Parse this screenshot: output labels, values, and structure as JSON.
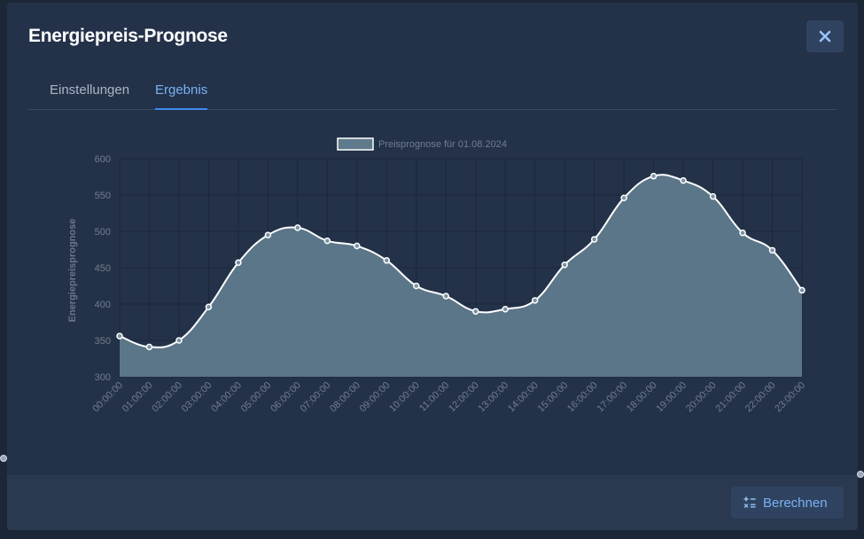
{
  "modal": {
    "title": "Energiepreis-Prognose",
    "close_icon": "close-icon"
  },
  "tabs": [
    {
      "label": "Einstellungen",
      "active": false
    },
    {
      "label": "Ergebnis",
      "active": true
    }
  ],
  "footer": {
    "calculate_label": "Berechnen",
    "calculate_icon": "calculator-icon"
  },
  "colors": {
    "accent": "#7ab1f5",
    "area_fill": "#5f7a8c",
    "line": "#ffffff"
  },
  "chart_data": {
    "type": "area",
    "legend": "Preisprognose für 01.08.2024",
    "legend_position": "top-center",
    "ylabel": "Energiepreisprognose",
    "ylim": [
      300,
      600
    ],
    "yticks": [
      300,
      350,
      400,
      450,
      500,
      550,
      600
    ],
    "grid": true,
    "x": [
      "00:00:00",
      "01:00:00",
      "02:00:00",
      "03:00:00",
      "04:00:00",
      "05:00:00",
      "06:00:00",
      "07:00:00",
      "08:00:00",
      "09:00:00",
      "10:00:00",
      "11:00:00",
      "12:00:00",
      "13:00:00",
      "14:00:00",
      "15:00:00",
      "16:00:00",
      "17:00:00",
      "18:00:00",
      "19:00:00",
      "20:00:00",
      "21:00:00",
      "22:00:00",
      "23:00:00"
    ],
    "series": [
      {
        "name": "Preisprognose für 01.08.2024",
        "values": [
          356,
          341,
          350,
          396,
          457,
          495,
          505,
          487,
          480,
          460,
          425,
          411,
          390,
          393,
          405,
          454,
          489,
          546,
          576,
          570,
          548,
          498,
          474,
          419
        ]
      }
    ]
  }
}
